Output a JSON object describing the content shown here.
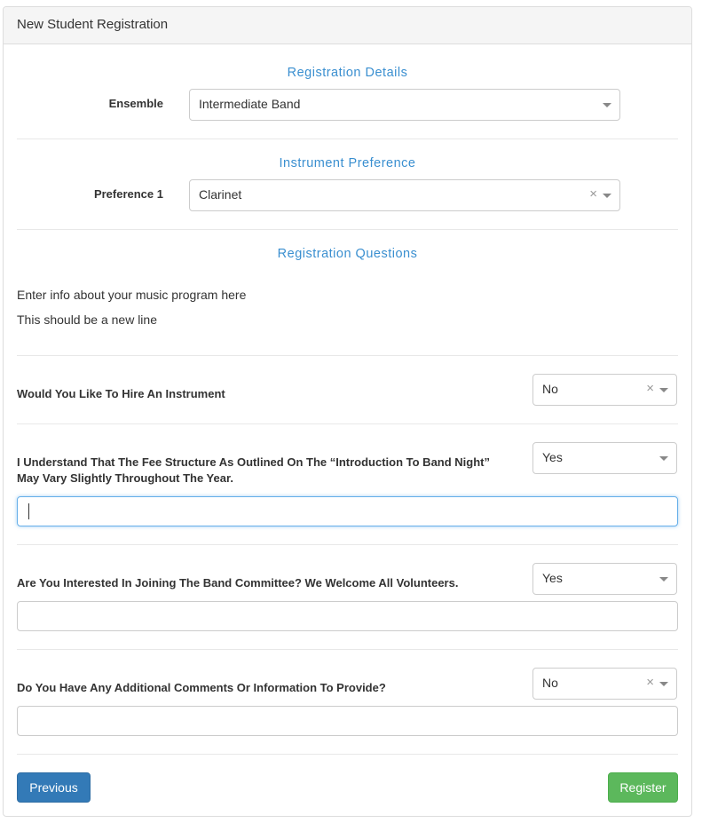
{
  "panel": {
    "title": "New Student Registration"
  },
  "registration_details": {
    "heading": "Registration Details",
    "ensemble_label": "Ensemble",
    "ensemble_value": "Intermediate Band"
  },
  "instrument_preference": {
    "heading": "Instrument Preference",
    "preference_label": "Preference 1",
    "preference_value": "Clarinet",
    "clear_icon": "×"
  },
  "registration_questions": {
    "heading": "Registration Questions",
    "info_line1": "Enter info about your music program here",
    "info_line2": "This should be a new line",
    "questions": [
      {
        "text": "Would You Like To Hire An Instrument",
        "answer": "No",
        "clearable": true
      },
      {
        "text": "I Understand That The Fee Structure As Outlined On The “Introduction To Band Night” May Vary Slightly Throughout The Year.",
        "answer": "Yes",
        "clearable": false,
        "input_value": ""
      },
      {
        "text": "Are You Interested In Joining The Band Committee? We Welcome All Volunteers.",
        "answer": "Yes",
        "clearable": false,
        "input_value": ""
      },
      {
        "text": "Do You Have Any Additional Comments Or Information To Provide?",
        "answer": "No",
        "clearable": true,
        "input_value": ""
      }
    ]
  },
  "buttons": {
    "previous": "Previous",
    "register": "Register"
  },
  "colors": {
    "section_heading": "#3a8fd0",
    "primary": "#337ab7",
    "success": "#5cb85c",
    "focus": "#66afe9"
  }
}
